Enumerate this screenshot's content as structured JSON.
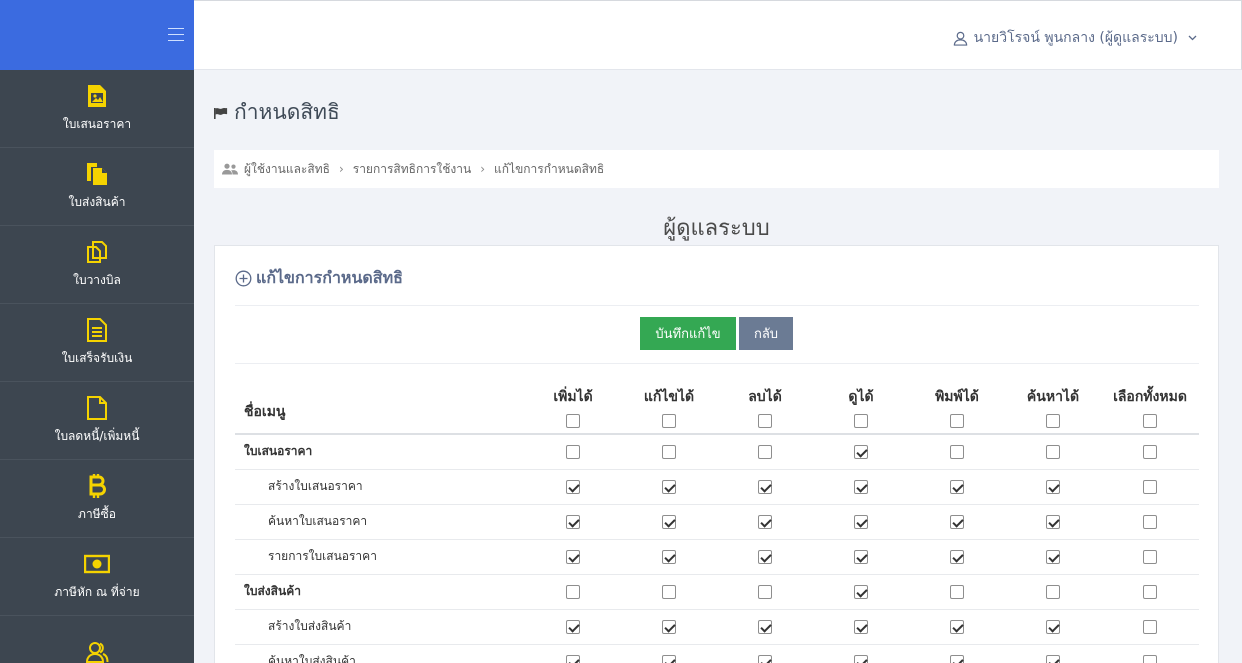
{
  "sidebar": {
    "items": [
      {
        "label": "ใบเสนอราคา",
        "icon": "image-file-icon"
      },
      {
        "label": "ใบส่งสินค้า",
        "icon": "file-copy-icon"
      },
      {
        "label": "ใบวางบิล",
        "icon": "clone-icon"
      },
      {
        "label": "ใบเสร็จรับเงิน",
        "icon": "document-text-icon"
      },
      {
        "label": "ใบลดหนี้/เพิ่มหนี้",
        "icon": "file-icon"
      },
      {
        "label": "ภาษีซื้อ",
        "icon": "bitcoin-icon"
      },
      {
        "label": "ภาษีหัก ณ ที่จ่าย",
        "icon": "money-icon"
      },
      {
        "label": "",
        "icon": "users-icon"
      }
    ]
  },
  "topbar": {
    "user_name": "นายวิโรจน์ พูนกลาง (ผู้ดูแลระบบ)"
  },
  "page": {
    "title": "กำหนดสิทธิ",
    "breadcrumb": [
      "ผู้ใช้งานและสิทธิ",
      "รายการสิทธิการใช้งาน",
      "แก้ไขการกำหนดสิทธิ"
    ],
    "role_name": "ผู้ดูแลระบบ"
  },
  "card": {
    "title": "แก้ไขการกำหนดสิทธิ",
    "save_label": "บันทึกแก้ไข",
    "back_label": "กลับ"
  },
  "table": {
    "name_header": "ชื่อเมนู",
    "columns": [
      "เพิ่มได้",
      "แก้ไขได้",
      "ลบได้",
      "ดูได้",
      "พิมพ์ได้",
      "ค้นหาได้",
      "เลือกทั้งหมด"
    ],
    "header_checks": [
      false,
      false,
      false,
      false,
      false,
      false,
      false
    ],
    "rows": [
      {
        "name": "ใบเสนอราคา",
        "type": "group",
        "checks": [
          false,
          false,
          false,
          true,
          false,
          false,
          false
        ]
      },
      {
        "name": "สร้างใบเสนอราคา",
        "type": "child",
        "checks": [
          true,
          true,
          true,
          true,
          true,
          true,
          false
        ]
      },
      {
        "name": "ค้นหาใบเสนอราคา",
        "type": "child",
        "checks": [
          true,
          true,
          true,
          true,
          true,
          true,
          false
        ]
      },
      {
        "name": "รายการใบเสนอราคา",
        "type": "child",
        "checks": [
          true,
          true,
          true,
          true,
          true,
          true,
          false
        ]
      },
      {
        "name": "ใบส่งสินค้า",
        "type": "group",
        "checks": [
          false,
          false,
          false,
          true,
          false,
          false,
          false
        ]
      },
      {
        "name": "สร้างใบส่งสินค้า",
        "type": "child",
        "checks": [
          true,
          true,
          true,
          true,
          true,
          true,
          false
        ]
      },
      {
        "name": "ค้นหาใบส่งสินค้า",
        "type": "child",
        "checks": [
          true,
          true,
          true,
          true,
          true,
          true,
          false
        ]
      }
    ]
  },
  "colors": {
    "sidebar_bg": "#3d4650",
    "brand_bg": "#3b6be0",
    "icon_yellow": "#f5d300",
    "save_green": "#34a853",
    "back_gray": "#6b7b94"
  }
}
